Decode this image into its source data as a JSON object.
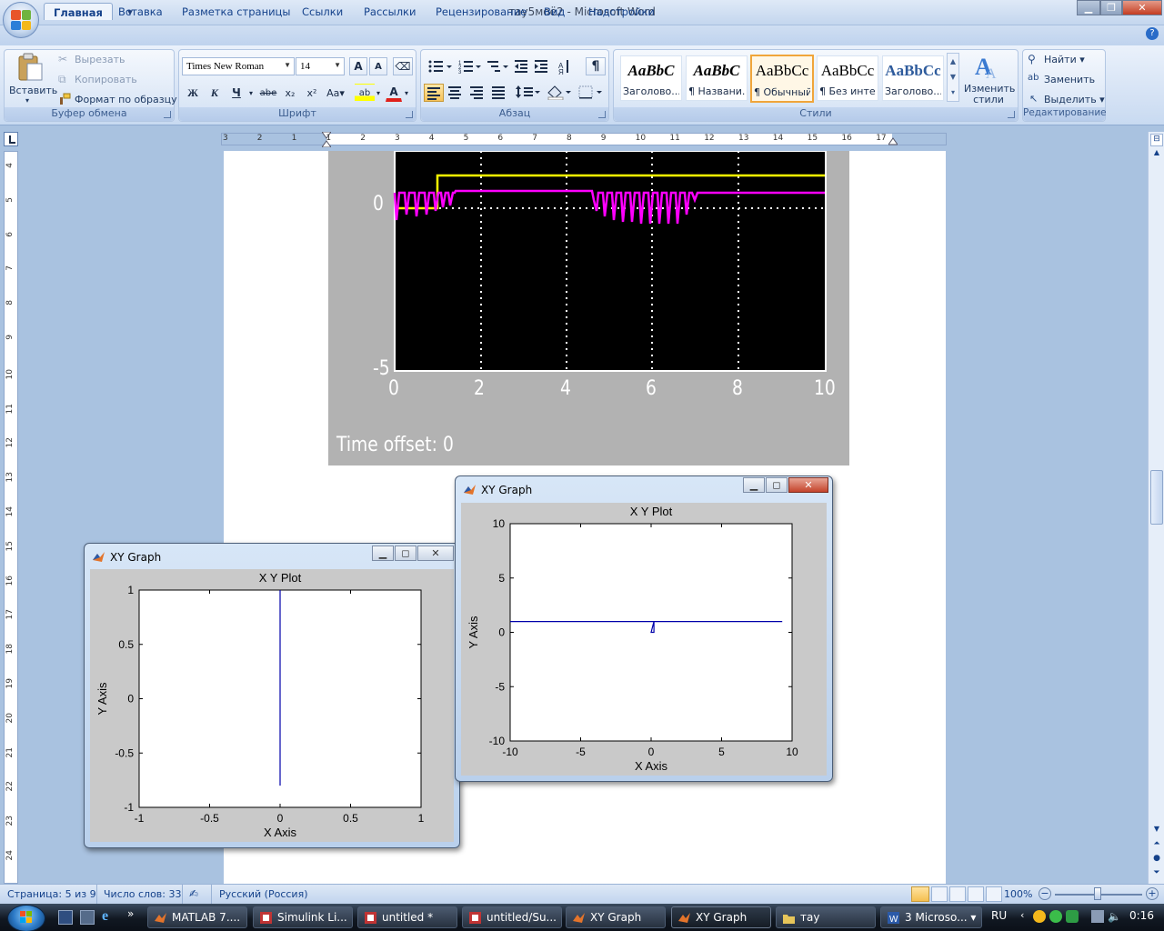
{
  "window": {
    "title": "тау5моё2 - Microsoft Word",
    "buttons": {
      "minimize": "▁",
      "maximize": "❐",
      "close": "✕"
    }
  },
  "qat": {
    "save": "save-icon",
    "undo": "undo-icon",
    "redo": "redo-icon",
    "more": "▾"
  },
  "tabs": [
    "Главная",
    "Вставка",
    "Разметка страницы",
    "Ссылки",
    "Рассылки",
    "Рецензирование",
    "Вид",
    "Надстройки"
  ],
  "ribbon": {
    "clipboard": {
      "label": "Буфер обмена",
      "paste": "Вставить",
      "cut": "Вырезать",
      "copy": "Копировать",
      "format_painter": "Формат по образцу"
    },
    "font": {
      "label": "Шрифт",
      "font_name": "Times New Roman",
      "font_size": "14",
      "grow": "A",
      "shrink": "A",
      "clear": "⌫",
      "bold": "Ж",
      "italic": "К",
      "underline": "Ч",
      "strike": "abe",
      "subscript": "x₂",
      "superscript": "x²",
      "case": "Aa",
      "highlight": "ab",
      "font_color": "A"
    },
    "paragraph": {
      "label": "Абзац",
      "pilcrow": "¶"
    },
    "styles": {
      "label": "Стили",
      "items": [
        {
          "sample": "AaBbC",
          "name": "Заголово..."
        },
        {
          "sample": "AaBbC",
          "name": "¶ Названи..."
        },
        {
          "sample": "AaBbCc",
          "name": "¶ Обычный"
        },
        {
          "sample": "AaBbCc",
          "name": "¶ Без инте..."
        },
        {
          "sample": "AaBbCc",
          "name": "Заголово..."
        }
      ],
      "change_styles": "Изменить стили"
    },
    "editing": {
      "label": "Редактирование",
      "find": "Найти",
      "replace": "Заменить",
      "select": "Выделить"
    }
  },
  "ruler": {
    "h_labels": [
      "3",
      "2",
      "1",
      "1",
      "2",
      "3",
      "4",
      "5",
      "6",
      "7",
      "8",
      "9",
      "10",
      "11",
      "12",
      "13",
      "14",
      "15",
      "16",
      "17"
    ],
    "v_labels": [
      "4",
      "5",
      "6",
      "7",
      "8",
      "9",
      "10",
      "11",
      "12",
      "13",
      "14",
      "15",
      "16",
      "17",
      "18",
      "19",
      "20",
      "21",
      "22",
      "23",
      "24"
    ]
  },
  "scope": {
    "y_labels": [
      "0",
      "-5"
    ],
    "x_labels": [
      "0",
      "2",
      "4",
      "6",
      "8",
      "10"
    ],
    "time_offset_label": "Time offset:",
    "time_offset_value": "0",
    "colors": {
      "step": "#ffff00",
      "signal": "#ff00ff",
      "zero_line": "#ffffff"
    }
  },
  "xy_graph_left": {
    "window_title": "XY Graph",
    "chart_data": {
      "type": "line",
      "title": "X Y Plot",
      "xlabel": "X Axis",
      "ylabel": "Y Axis",
      "xlim": [
        -1,
        1
      ],
      "ylim": [
        -1,
        1
      ],
      "x_ticks": [
        "-1",
        "-0.5",
        "0",
        "0.5",
        "1"
      ],
      "y_ticks": [
        "1",
        "0.5",
        "0",
        "-0.5",
        "-1"
      ],
      "series": [
        {
          "x": [
            0,
            0
          ],
          "y": [
            -0.8,
            1
          ]
        }
      ],
      "line_color": "#0000aa"
    }
  },
  "xy_graph_right": {
    "window_title": "XY Graph",
    "chart_data": {
      "type": "line",
      "title": "X Y Plot",
      "xlabel": "X Axis",
      "ylabel": "Y Axis",
      "xlim": [
        -10,
        10
      ],
      "ylim": [
        -10,
        10
      ],
      "x_ticks": [
        "-10",
        "-5",
        "0",
        "5",
        "10"
      ],
      "y_ticks": [
        "10",
        "5",
        "0",
        "-5",
        "-10"
      ],
      "series": [
        {
          "x": [
            -10,
            0.2,
            0.2,
            0,
            0.2,
            9.3
          ],
          "y": [
            1,
            1,
            0,
            0,
            1,
            1
          ]
        }
      ],
      "line_color": "#0000aa"
    }
  },
  "status": {
    "page": "Страница: 5 из 9",
    "words": "Число слов: 33",
    "language": "Русский (Россия)",
    "zoom": "100%"
  },
  "taskbar": {
    "items": [
      "MATLAB 7....",
      "Simulink Li...",
      "untitled *",
      "untitled/Su...",
      "XY Graph",
      "XY Graph",
      "тау",
      "3 Microso..."
    ],
    "lang": "RU",
    "time": "0:16"
  }
}
